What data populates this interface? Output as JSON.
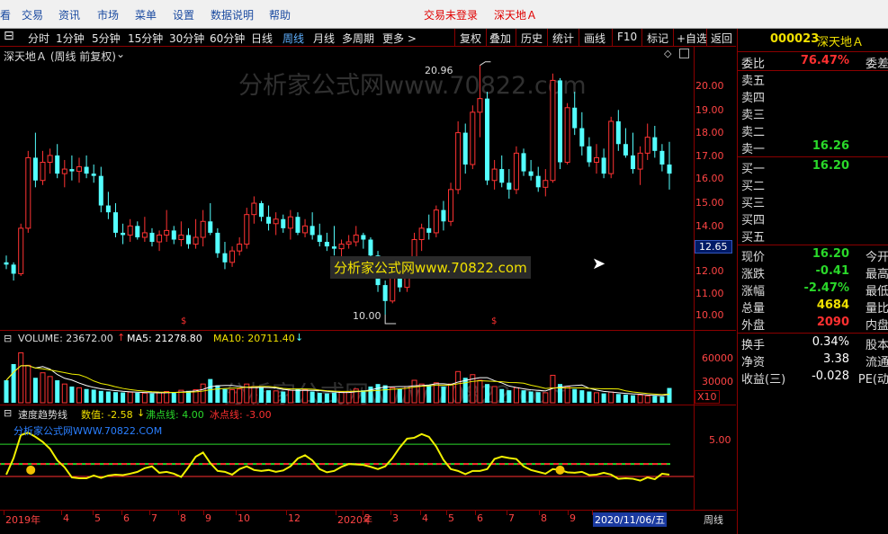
{
  "menu": {
    "items": [
      "看",
      "交易",
      "资讯",
      "市场",
      "菜单",
      "设置",
      "数据说明",
      "帮助"
    ],
    "status": "交易未登录",
    "stock_title": "深天地Ａ"
  },
  "toolbar": {
    "periods": [
      "分时",
      "1分钟",
      "5分钟",
      "15分钟",
      "30分钟",
      "60分钟",
      "日线",
      "周线",
      "月线",
      "多周期"
    ],
    "active": "周线",
    "more": "更多 >",
    "actions": [
      "复权",
      "叠加",
      "历史",
      "统计",
      "画线",
      "F10",
      "标记",
      "+自选",
      "返回"
    ]
  },
  "main_chart": {
    "title": "深天地Ａ (周线 前复权)",
    "watermark": "分析家公式网www.70822.com",
    "banner": "分析家公式网www.70822.com",
    "high_label": "20.96",
    "low_label": "10.00",
    "crosshair_price": "12.65",
    "price_ticks": [
      "20.00",
      "19.00",
      "18.00",
      "17.00",
      "16.00",
      "15.00",
      "14.00",
      "13.00",
      "12.00",
      "11.00",
      "10.00"
    ],
    "dividend_mark": "$"
  },
  "volume_panel": {
    "label": "VOLUME: 23672.00",
    "ma5": "MA5: 21278.80",
    "ma10": "MA10: 20711.40",
    "ticks": [
      "60000",
      "30000"
    ],
    "unit": "X10"
  },
  "indicator_panel": {
    "name": "速度趋势线",
    "value": "数值: -2.58",
    "boil": "沸点线: 4.00",
    "freeze": "冰点线: -3.00",
    "watermark": "分析家公式网WWW.70822.COM",
    "tick": "5.00"
  },
  "timeline": {
    "labels": [
      "2019年",
      "4",
      "5",
      "6",
      "7",
      "8",
      "9",
      "10",
      "12",
      "2020年",
      "2",
      "3",
      "4",
      "5",
      "6",
      "7",
      "8",
      "9",
      "10"
    ],
    "cursor_date": "2020/11/06/五",
    "period": "周线"
  },
  "quote": {
    "code": "000023",
    "name": "深天地Ａ",
    "webi": {
      "label": "委比",
      "value": "76.47%",
      "right": "委差"
    },
    "sell": [
      "卖五",
      "卖四",
      "卖三",
      "卖二",
      "卖一"
    ],
    "sell1_price": "16.26",
    "buy": [
      "买一",
      "买二",
      "买三",
      "买四",
      "买五"
    ],
    "buy1_price": "16.20",
    "stats": [
      {
        "label": "现价",
        "value": "16.20",
        "right": "今开",
        "color": "#2ad82a"
      },
      {
        "label": "涨跌",
        "value": "-0.41",
        "right": "最高",
        "color": "#2ad82a"
      },
      {
        "label": "涨幅",
        "value": "-2.47%",
        "right": "最低",
        "color": "#2ad82a"
      },
      {
        "label": "总量",
        "value": "4684",
        "right": "量比",
        "color": "#f0e000"
      },
      {
        "label": "外盘",
        "value": "2090",
        "right": "内盘",
        "color": "#ff3030"
      }
    ],
    "fin": [
      {
        "label": "换手",
        "value": "0.34%",
        "right": "股本"
      },
      {
        "label": "净资",
        "value": "3.38",
        "right": "流通"
      },
      {
        "label": "收益(三)",
        "value": "-0.028",
        "right": "PE(动"
      }
    ]
  },
  "colors": {
    "up": "#ff3333",
    "down": "#54ffff",
    "grid": "#8b0000",
    "ma_white": "#ffffff",
    "ma_yellow": "#f0f000",
    "green": "#2ad82a",
    "red": "#ff3030"
  },
  "chart_data": {
    "type": "candlestick",
    "x": [
      "2019-01-04",
      "2019-01-11",
      "2019-01-18",
      "2019-01-25",
      "2019-02-01",
      "2019-02-15",
      "2019-02-22",
      "2019-03-01",
      "2019-03-08",
      "2019-03-15",
      "2019-03-22",
      "2019-03-29",
      "2019-04-04",
      "2019-04-12",
      "2019-04-19",
      "2019-04-26",
      "2019-05-10",
      "2019-05-17",
      "2019-05-24",
      "2019-05-31",
      "2019-06-06",
      "2019-06-14",
      "2019-06-21",
      "2019-06-28",
      "2019-07-05",
      "2019-07-12",
      "2019-07-19",
      "2019-07-26",
      "2019-08-02",
      "2019-08-09",
      "2019-08-16",
      "2019-08-23",
      "2019-08-30",
      "2019-09-06",
      "2019-09-12",
      "2019-09-20",
      "2019-09-27",
      "2019-10-11",
      "2019-10-18",
      "2019-10-25",
      "2019-11-01",
      "2019-11-08",
      "2019-11-15",
      "2019-11-22",
      "2019-11-29",
      "2019-12-06",
      "2019-12-13",
      "2019-12-20",
      "2019-12-27",
      "2020-01-03",
      "2020-01-10",
      "2020-01-17",
      "2020-01-23",
      "2020-02-07",
      "2020-02-14",
      "2020-02-21",
      "2020-02-28",
      "2020-03-06",
      "2020-03-13",
      "2020-03-20",
      "2020-03-27",
      "2020-04-03",
      "2020-04-10",
      "2020-04-17",
      "2020-04-24",
      "2020-04-30",
      "2020-05-08",
      "2020-05-15",
      "2020-05-22",
      "2020-05-29",
      "2020-06-05",
      "2020-06-12",
      "2020-06-19",
      "2020-06-24",
      "2020-07-03",
      "2020-07-10",
      "2020-07-17",
      "2020-07-24",
      "2020-07-31",
      "2020-08-07",
      "2020-08-14",
      "2020-08-21",
      "2020-08-28",
      "2020-09-04",
      "2020-09-11",
      "2020-09-18",
      "2020-09-25",
      "2020-09-30",
      "2020-10-16",
      "2020-10-23",
      "2020-10-30",
      "2020-11-06"
    ],
    "series": [
      {
        "name": "K线",
        "ohlc": [
          [
            12.3,
            12.6,
            12.0,
            12.2
          ],
          [
            12.2,
            12.3,
            11.5,
            11.8
          ],
          [
            11.8,
            14.0,
            11.7,
            13.8
          ],
          [
            13.8,
            17.2,
            13.6,
            16.9
          ],
          [
            16.9,
            18.0,
            15.6,
            15.9
          ],
          [
            15.9,
            17.2,
            15.7,
            16.7
          ],
          [
            16.7,
            17.3,
            16.2,
            17.0
          ],
          [
            17.0,
            17.5,
            16.0,
            16.2
          ],
          [
            16.2,
            16.8,
            15.6,
            16.4
          ],
          [
            16.4,
            17.0,
            15.9,
            16.3
          ],
          [
            16.3,
            16.9,
            15.8,
            16.5
          ],
          [
            16.5,
            17.0,
            16.0,
            16.2
          ],
          [
            16.2,
            16.6,
            15.8,
            16.1
          ],
          [
            16.1,
            16.5,
            14.5,
            14.8
          ],
          [
            14.8,
            15.4,
            14.2,
            14.5
          ],
          [
            14.5,
            14.9,
            13.4,
            13.6
          ],
          [
            13.6,
            14.0,
            13.1,
            13.5
          ],
          [
            13.5,
            14.2,
            13.2,
            13.9
          ],
          [
            13.9,
            14.1,
            13.3,
            13.4
          ],
          [
            13.4,
            14.3,
            13.2,
            13.6
          ],
          [
            13.6,
            13.8,
            13.0,
            13.2
          ],
          [
            13.2,
            13.7,
            12.8,
            13.5
          ],
          [
            13.5,
            14.6,
            13.2,
            13.7
          ],
          [
            13.7,
            13.9,
            13.1,
            13.3
          ],
          [
            13.3,
            14.1,
            13.0,
            13.5
          ],
          [
            13.5,
            13.8,
            12.9,
            13.1
          ],
          [
            13.1,
            14.2,
            12.9,
            13.4
          ],
          [
            13.4,
            14.6,
            13.0,
            14.1
          ],
          [
            14.1,
            14.9,
            13.5,
            13.6
          ],
          [
            13.6,
            13.8,
            12.5,
            12.7
          ],
          [
            12.7,
            13.2,
            12.0,
            12.3
          ],
          [
            12.3,
            13.0,
            12.1,
            12.8
          ],
          [
            12.8,
            13.4,
            12.6,
            13.1
          ],
          [
            13.1,
            14.7,
            12.9,
            14.4
          ],
          [
            14.4,
            15.2,
            14.0,
            14.9
          ],
          [
            14.9,
            15.0,
            14.1,
            14.3
          ],
          [
            14.3,
            14.8,
            13.7,
            14.0
          ],
          [
            14.0,
            14.5,
            13.5,
            14.2
          ],
          [
            14.2,
            14.4,
            13.6,
            13.8
          ],
          [
            13.8,
            14.6,
            13.3,
            14.3
          ],
          [
            14.3,
            14.5,
            13.5,
            13.6
          ],
          [
            13.6,
            14.2,
            13.4,
            13.9
          ],
          [
            13.9,
            14.5,
            13.3,
            13.5
          ],
          [
            13.5,
            14.0,
            13.0,
            13.2
          ],
          [
            13.2,
            13.6,
            12.8,
            13.0
          ],
          [
            13.0,
            13.9,
            12.6,
            12.9
          ],
          [
            12.9,
            13.3,
            12.5,
            13.1
          ],
          [
            13.1,
            13.5,
            12.9,
            13.2
          ],
          [
            13.2,
            13.9,
            13.0,
            13.5
          ],
          [
            13.5,
            13.6,
            12.9,
            13.3
          ],
          [
            13.3,
            13.4,
            12.3,
            12.6
          ],
          [
            12.6,
            12.8,
            11.0,
            11.3
          ],
          [
            11.3,
            11.5,
            10.0,
            10.6
          ],
          [
            10.6,
            11.8,
            10.5,
            11.6
          ],
          [
            11.6,
            12.3,
            11.0,
            11.2
          ],
          [
            11.2,
            12.1,
            11.0,
            11.9
          ],
          [
            11.9,
            13.6,
            11.7,
            13.3
          ],
          [
            13.3,
            14.0,
            12.8,
            13.8
          ],
          [
            13.8,
            14.4,
            13.3,
            13.6
          ],
          [
            13.6,
            14.8,
            13.4,
            14.6
          ],
          [
            14.6,
            15.0,
            13.7,
            14.1
          ],
          [
            14.1,
            15.8,
            13.9,
            15.5
          ],
          [
            15.5,
            18.5,
            15.3,
            18.0
          ],
          [
            18.0,
            18.4,
            16.2,
            16.6
          ],
          [
            16.6,
            19.2,
            16.4,
            18.9
          ],
          [
            18.9,
            20.96,
            17.8,
            19.5
          ],
          [
            19.5,
            19.8,
            15.7,
            15.9
          ],
          [
            15.9,
            16.8,
            15.5,
            16.4
          ],
          [
            16.4,
            17.0,
            15.6,
            15.8
          ],
          [
            15.8,
            16.4,
            15.1,
            15.5
          ],
          [
            15.5,
            17.4,
            15.3,
            17.1
          ],
          [
            17.1,
            17.3,
            16.1,
            16.3
          ],
          [
            16.3,
            16.8,
            15.9,
            16.1
          ],
          [
            16.1,
            16.5,
            15.4,
            15.6
          ],
          [
            15.6,
            16.4,
            15.2,
            15.9
          ],
          [
            15.9,
            20.6,
            15.8,
            20.3
          ],
          [
            20.3,
            20.4,
            16.4,
            16.7
          ],
          [
            16.7,
            19.3,
            16.6,
            19.1
          ],
          [
            19.1,
            19.8,
            17.9,
            18.2
          ],
          [
            18.2,
            18.9,
            17.0,
            17.4
          ],
          [
            17.4,
            17.8,
            16.5,
            16.7
          ],
          [
            16.7,
            17.5,
            16.2,
            16.9
          ],
          [
            16.9,
            17.3,
            16.0,
            16.2
          ],
          [
            16.2,
            18.7,
            16.0,
            18.5
          ],
          [
            18.5,
            19.0,
            17.2,
            17.5
          ],
          [
            17.5,
            18.2,
            16.9,
            17.0
          ],
          [
            17.0,
            18.0,
            16.2,
            16.4
          ],
          [
            16.4,
            17.4,
            15.7,
            17.1
          ],
          [
            17.1,
            18.4,
            16.8,
            17.8
          ],
          [
            17.8,
            18.3,
            16.9,
            17.2
          ],
          [
            17.2,
            17.5,
            16.3,
            16.6
          ],
          [
            16.6,
            17.6,
            15.5,
            16.2
          ]
        ]
      },
      {
        "name": "速度趋势线",
        "values": [
          -2.6,
          1.0,
          6.0,
          6.5,
          5.6,
          4.5,
          3.0,
          0.5,
          -1.0,
          -3.2,
          -3.4,
          -3.4,
          -2.8,
          -3.3,
          -2.8,
          -2.6,
          -2.7,
          -2.4,
          -2.0,
          -1.2,
          -0.8,
          -2.2,
          -2.0,
          -2.4,
          -3.1,
          -1.0,
          1.3,
          2.2,
          -0.1,
          -1.8,
          -2.0,
          -2.6,
          -1.4,
          -0.8,
          -1.6,
          -1.8,
          -1.6,
          -2.0,
          -1.7,
          -0.8,
          0.9,
          1.6,
          0.5,
          -1.4,
          -2.1,
          -1.8,
          -0.9,
          -0.3,
          -0.4,
          -0.5,
          -0.9,
          -1.4,
          -0.8,
          1.0,
          3.3,
          5.2,
          5.4,
          6.2,
          5.6,
          3.5,
          0.6,
          -1.4,
          -1.8,
          -2.5,
          -1.8,
          -1.8,
          -1.4,
          0.8,
          1.3,
          1.0,
          0.8,
          -0.8,
          -1.6,
          -2.0,
          -2.4,
          -1.4,
          -1.6,
          -2.1,
          -2.2,
          -2.0,
          -2.7,
          -2.6,
          -2.2,
          -2.6,
          -3.5,
          -3.4,
          -3.5,
          -3.9,
          -3.2,
          -3.6,
          -2.4,
          -2.6
        ]
      }
    ],
    "volume": [
      36000,
      62000,
      80000,
      60000,
      40000,
      48000,
      42000,
      36000,
      30000,
      26000,
      24000,
      22000,
      21000,
      19000,
      18000,
      17000,
      16500,
      17000,
      16000,
      15500,
      15000,
      16000,
      18000,
      17000,
      20000,
      19000,
      21000,
      30000,
      38000,
      28000,
      22000,
      21000,
      22000,
      30000,
      26000,
      24000,
      20000,
      19000,
      18000,
      20000,
      22000,
      21000,
      18000,
      16000,
      15000,
      16000,
      17000,
      18000,
      22000,
      20000,
      26000,
      30000,
      28000,
      24000,
      22000,
      26000,
      36000,
      30000,
      28000,
      32000,
      26000,
      30000,
      50000,
      40000,
      45000,
      36000,
      30000,
      26000,
      22000,
      20000,
      24000,
      20000,
      18000,
      17000,
      16000,
      44000,
      30000,
      26000,
      22000,
      20000,
      18000,
      16000,
      15000,
      17000,
      14000,
      13000,
      12000,
      12500,
      11000,
      11000,
      10000,
      23672
    ],
    "ylim": [
      10.0,
      21.2
    ],
    "volume_ylim": [
      0,
      85000
    ],
    "indicator_ylim": [
      -4.2,
      7.6
    ]
  }
}
